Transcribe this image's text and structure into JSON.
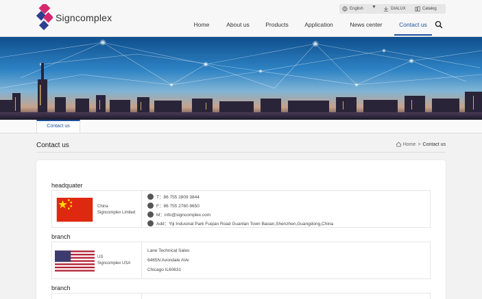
{
  "header": {
    "logo_text": "Signcomplex",
    "utility": {
      "language": "English",
      "dialux": "DIALUX",
      "catalog": "Catalog"
    },
    "nav": [
      "Home",
      "About us",
      "Products",
      "Application",
      "News center",
      "Contact us"
    ],
    "active_nav": "Contact us"
  },
  "subtab": {
    "label": "Contact us"
  },
  "page": {
    "title": "Contact us",
    "breadcrumb": {
      "home": "Home",
      "sep": ">",
      "current": "Contact us"
    }
  },
  "sections": {
    "headquater": {
      "label": "headquater",
      "org_line1": "China",
      "org_line2": "Signcomplex Limited",
      "tel": "T：86 755 2809 3844",
      "fax": "F：86 755 2760 8650",
      "mail": "M：info@signcomplex.com",
      "addr": "Add：Yiji Indusinal Park Fuqian Road Guanlan Town Baoan,Shenzhen,Guangdong,China"
    },
    "branch1": {
      "label": "branch",
      "org_line1": "US",
      "org_line2": "Signcomplex USA",
      "line1": "Lane Technical Sales",
      "line2": "6465N Avondale AVe",
      "line3": "Chicago IL60631"
    },
    "branch2": {
      "label": "branch"
    }
  },
  "colors": {
    "accent": "#1a4f9c",
    "logo_magenta": "#d4286f",
    "logo_blue": "#2b3e8f"
  }
}
